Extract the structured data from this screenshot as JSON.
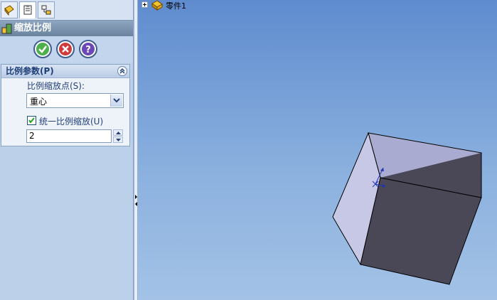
{
  "panel": {
    "title": "缩放比例",
    "tabs": [
      "feature-manager-tab",
      "property-manager-tab",
      "configuration-manager-tab"
    ],
    "buttons": {
      "ok": "ok-icon",
      "cancel": "cancel-icon",
      "help": "help-icon"
    }
  },
  "group": {
    "title": "比例参数(P)",
    "scale_point_label": "比例缩放点(S):",
    "scale_point_value": "重心",
    "uniform_label": "统一比例缩放(U)",
    "uniform_checked": true,
    "factor_value": "2"
  },
  "tree": {
    "part_name": "零件1"
  },
  "colors": {
    "accent": "#1f3f78",
    "viewport_top": "#5f8ccf",
    "viewport_bottom": "#a3c2e6"
  }
}
